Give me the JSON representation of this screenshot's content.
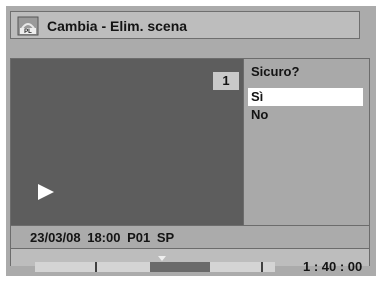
{
  "header": {
    "icon_label": "PL",
    "title": "Cambia - Elim. scena"
  },
  "preview": {
    "scene_number": "1"
  },
  "dialog": {
    "question": "Sicuro?",
    "options": [
      {
        "label": "Sì",
        "selected": true
      },
      {
        "label": "No",
        "selected": false
      }
    ]
  },
  "info": {
    "text": "23/03/08  18:00  P01  SP"
  },
  "progress": {
    "time": "1 : 40 : 00",
    "cursor_fraction": 0.53,
    "segment_start_fraction": 0.48,
    "segment_end_fraction": 0.73,
    "marks_fraction": [
      0.25,
      0.94
    ]
  },
  "colors": {
    "screen_bg": "#ababab",
    "video_bg": "#5d5d5d",
    "selected_bg": "#ffffff"
  }
}
